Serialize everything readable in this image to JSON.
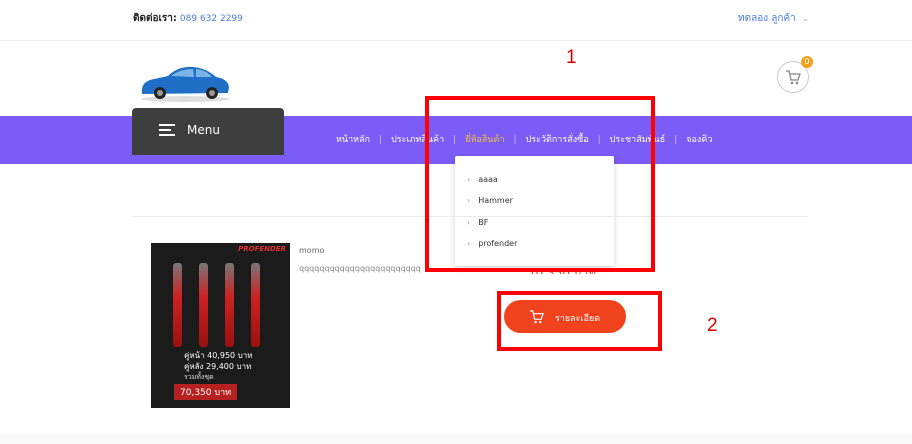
{
  "topbar": {
    "contact_label": "ติดต่อเรา:",
    "phone": "089 632 2299",
    "account_label": "ทดลอง ลูกค้า",
    "account_chevron": "⌄"
  },
  "cart": {
    "count": "0",
    "icon": "cart-icon"
  },
  "menu": {
    "label": "Menu"
  },
  "nav": {
    "links": [
      "หน้าหลัก",
      "ประเภทสินค้า",
      "ยี่ห้อสินค้า",
      "ประวัติการสั่งซื้อ",
      "ประชาสัมพันธ์",
      "จองคิว"
    ],
    "active_index": 2
  },
  "dropdown": {
    "items": [
      "aaaa",
      "Hammer",
      "BF",
      "profender"
    ]
  },
  "product": {
    "name": "momo",
    "description": "qqqqqqqqqqqqqqqqqqqqqqqq",
    "price": "70,350 บาท",
    "detail_button": "รายละเอียด",
    "image": {
      "brand": "PROFENDER",
      "front": "คู่หน้า 40,950 บาท",
      "rear": "คู่หลัง 29,400 บาท",
      "set_label": "รวมทั้งชุด",
      "total": "70,350 บาท"
    }
  },
  "annotations": {
    "first": "1",
    "second": "2"
  },
  "colors": {
    "nav": "#7b5cf6",
    "accent": "#f0421d",
    "annotation": "#ff0000",
    "active_link": "#f0c33c"
  }
}
